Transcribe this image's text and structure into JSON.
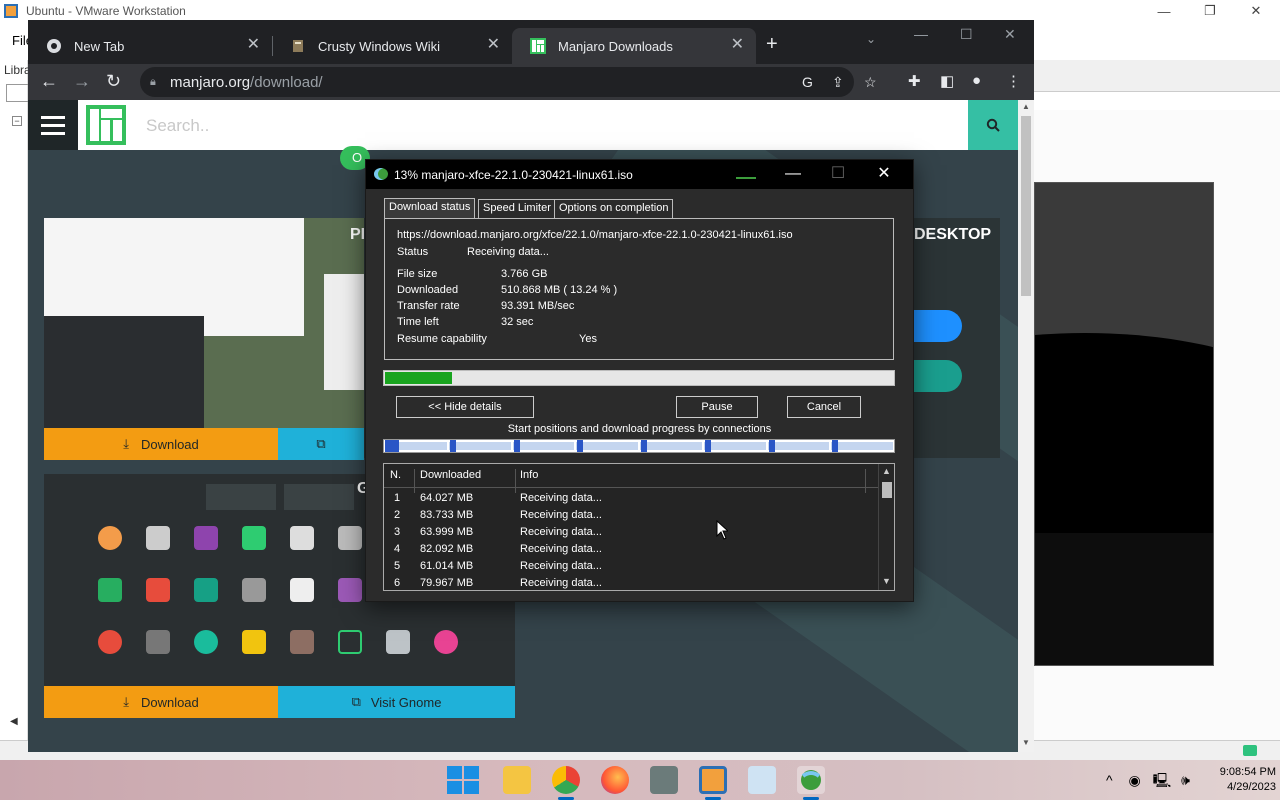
{
  "host": {
    "title": "Ubuntu - VMware Workstation",
    "menu_file": "File",
    "library_label": "Libra",
    "minimize": "—",
    "maximize": "❐",
    "close": "✕"
  },
  "browser": {
    "tabs": [
      {
        "label": "New Tab",
        "icon": "chrome-icon",
        "active": false
      },
      {
        "label": "Crusty Windows Wiki",
        "icon": "wiki-icon",
        "active": false
      },
      {
        "label": "Manjaro Downloads",
        "icon": "manjaro-icon",
        "active": true
      }
    ],
    "new_tab": "+",
    "url_host": "manjaro.org",
    "url_path": "/download/"
  },
  "site": {
    "search_placeholder": "Search..",
    "pill_text": "O",
    "card1_title": "PI",
    "card2_title": "G",
    "right_card_title": "DESKTOP",
    "download_label": "Download",
    "visit_gnome_label": "Visit Gnome"
  },
  "idm": {
    "title": "13% manjaro-xfce-22.1.0-230421-linux61.iso",
    "tabs": [
      "Download status",
      "Speed Limiter",
      "Options on completion"
    ],
    "url": "https://download.manjaro.org/xfce/22.1.0/manjaro-xfce-22.1.0-230421-linux61.iso",
    "status_label": "Status",
    "status_value": "Receiving data...",
    "file_size_label": "File size",
    "file_size_value": "3.766  GB",
    "downloaded_label": "Downloaded",
    "downloaded_value": "510.868  MB  ( 13.24 % )",
    "rate_label": "Transfer rate",
    "rate_value": "93.391  MB/sec",
    "time_left_label": "Time left",
    "time_left_value": "32 sec",
    "resume_label": "Resume capability",
    "resume_value": "Yes",
    "progress": 0.1324,
    "hide_details": "<< Hide details",
    "pause": "Pause",
    "cancel": "Cancel",
    "connections_label": "Start positions and download progress by connections",
    "table_headers": [
      "N.",
      "Downloaded",
      "Info"
    ],
    "connections": [
      {
        "n": "1",
        "downloaded": "64.027  MB",
        "info": "Receiving data..."
      },
      {
        "n": "2",
        "downloaded": "83.733  MB",
        "info": "Receiving data..."
      },
      {
        "n": "3",
        "downloaded": "63.999  MB",
        "info": "Receiving data..."
      },
      {
        "n": "4",
        "downloaded": "82.092  MB",
        "info": "Receiving data..."
      },
      {
        "n": "5",
        "downloaded": "61.014  MB",
        "info": "Receiving data..."
      },
      {
        "n": "6",
        "downloaded": "79.967  MB",
        "info": "Receiving data..."
      }
    ]
  },
  "taskbar": {
    "time": "9:08:54 PM",
    "date": "4/29/2023"
  },
  "colors": {
    "manjaro_green": "#35bf5c",
    "download_orange": "#f39c12",
    "visit_blue": "#1fb1d9",
    "progress_green": "#19a41f"
  }
}
